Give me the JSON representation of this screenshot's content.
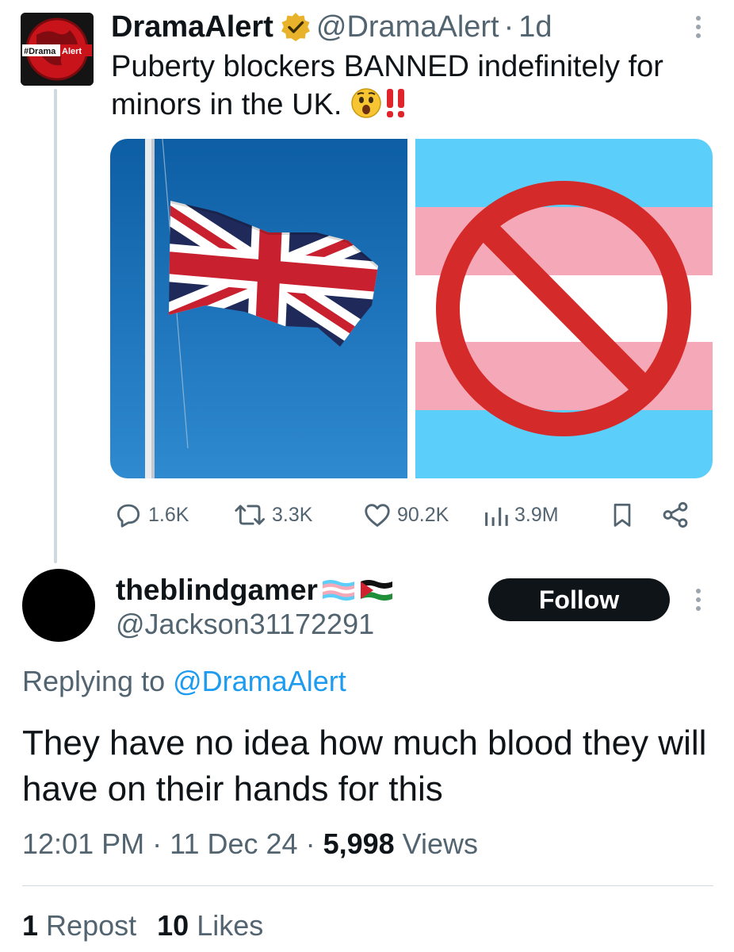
{
  "quoted_tweet": {
    "author_name": "DramaAlert",
    "handle": "@DramaAlert",
    "separator": "·",
    "time": "1d",
    "text": "Puberty blockers BANNED indefinitely for minors in the UK.",
    "text_emoji": "😲‼️",
    "avatar_label_left": "#Drama",
    "avatar_label_right": "Alert",
    "verified_icon": "gold-verified-badge",
    "actions": {
      "replies": "1.6K",
      "reposts": "3.3K",
      "likes": "90.2K",
      "views": "3.9M"
    }
  },
  "reply_tweet": {
    "author_name": "theblindgamer",
    "name_flags": [
      "transgender-flag",
      "palestine-flag"
    ],
    "handle": "@Jackson31172291",
    "follow_label": "Follow",
    "replying_prefix": "Replying to",
    "replying_to": "@DramaAlert",
    "text": "They have no idea how much blood they will have on their hands for this",
    "time": "12:01 PM",
    "date": "11 Dec 24",
    "views_count": "5,998",
    "views_label": "Views",
    "reposts_count": "1",
    "reposts_label": "Repost",
    "likes_count": "10",
    "likes_label": "Likes"
  },
  "colors": {
    "text_primary": "#0f1419",
    "text_secondary": "#536471",
    "link": "#1d9bf0",
    "thread_line": "#cfd9de",
    "verified_gold": "#e8b32a",
    "trans_blue": "#5bcefa",
    "trans_pink": "#f5a9b8",
    "prohibition_red": "#d42a2a"
  }
}
